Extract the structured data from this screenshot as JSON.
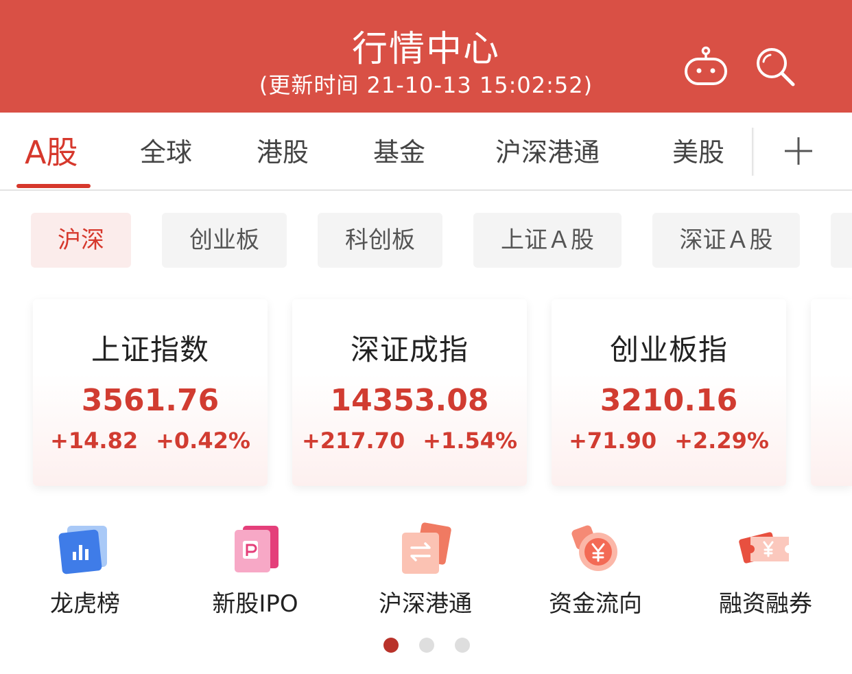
{
  "header": {
    "title": "行情中心",
    "subtitle": "(更新时间 21-10-13 15:02:52)"
  },
  "tabs": [
    {
      "label": "A股",
      "active": true
    },
    {
      "label": "全球",
      "active": false
    },
    {
      "label": "港股",
      "active": false
    },
    {
      "label": "基金",
      "active": false
    },
    {
      "label": "沪深港通",
      "active": false
    },
    {
      "label": "美股",
      "active": false
    }
  ],
  "filters": [
    {
      "label": "沪深",
      "active": true
    },
    {
      "label": "创业板",
      "active": false
    },
    {
      "label": "科创板",
      "active": false
    },
    {
      "label": "上证Ａ股",
      "active": false
    },
    {
      "label": "深证Ａ股",
      "active": false
    }
  ],
  "indices": [
    {
      "name": "上证指数",
      "value": "3561.76",
      "change": "+14.82",
      "percent": "+0.42%"
    },
    {
      "name": "深证成指",
      "value": "14353.08",
      "change": "+217.70",
      "percent": "+1.54%"
    },
    {
      "name": "创业板指",
      "value": "3210.16",
      "change": "+71.90",
      "percent": "+2.29%"
    }
  ],
  "functions": [
    {
      "label": "龙虎榜",
      "icon": "chart-card-icon"
    },
    {
      "label": "新股IPO",
      "icon": "ipo-card-icon"
    },
    {
      "label": "沪深港通",
      "icon": "transfer-card-icon"
    },
    {
      "label": "资金流向",
      "icon": "yuan-coin-icon"
    },
    {
      "label": "融资融券",
      "icon": "yuan-ticket-icon"
    }
  ],
  "pagination": {
    "current": 1,
    "total": 3
  },
  "colors": {
    "header_bg": "#d95045",
    "accent_red": "#d6382c",
    "value_red": "#d13c31",
    "chip_bg": "#f4f4f4",
    "chip_active_bg": "#fbeceb"
  }
}
